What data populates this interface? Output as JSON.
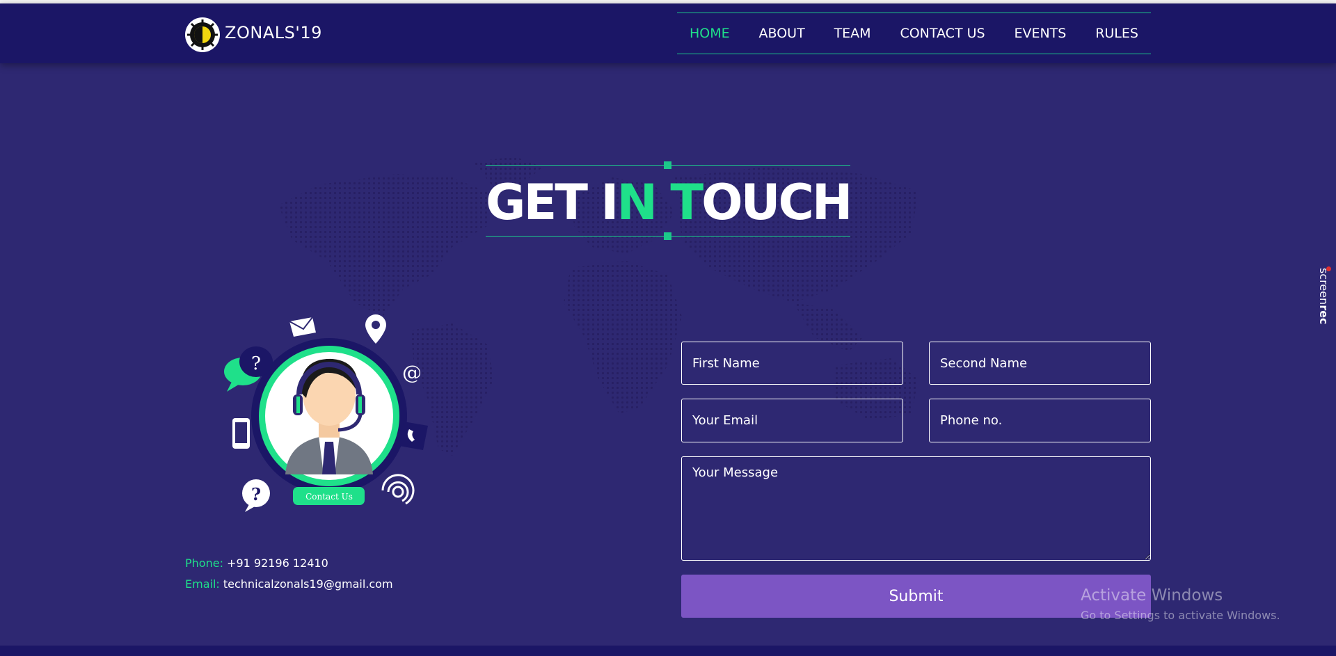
{
  "brand": {
    "name": "ZONALS'19"
  },
  "nav": {
    "items": [
      {
        "label": "HOME",
        "active": true
      },
      {
        "label": "ABOUT"
      },
      {
        "label": "TEAM"
      },
      {
        "label": "CONTACT US"
      },
      {
        "label": "EVENTS"
      },
      {
        "label": "RULES"
      }
    ]
  },
  "hero": {
    "title_part1": "GET I",
    "title_green1": "N",
    "title_space": " ",
    "title_green2": "T",
    "title_part2": "OUCH"
  },
  "illustration": {
    "badge": "Contact Us"
  },
  "contact": {
    "phone_label": "Phone:",
    "phone": "+91 92196 12410",
    "email_label": "Email:",
    "email": "technicalzonals19@gmail.com"
  },
  "form": {
    "first_name": "First Name",
    "second_name": "Second Name",
    "email": "Your Email",
    "phone": "Phone no.",
    "message": "Your Message",
    "submit": "Submit"
  },
  "overlay": {
    "screenrec": "screen",
    "screenrec_bold": "rec",
    "activate_title": "Activate Windows",
    "activate_sub": "Go to Settings to activate Windows."
  },
  "colors": {
    "background": "#2e2872",
    "navbar": "#1b1666",
    "accent": "#1fe08a",
    "button": "#7c55c4"
  }
}
